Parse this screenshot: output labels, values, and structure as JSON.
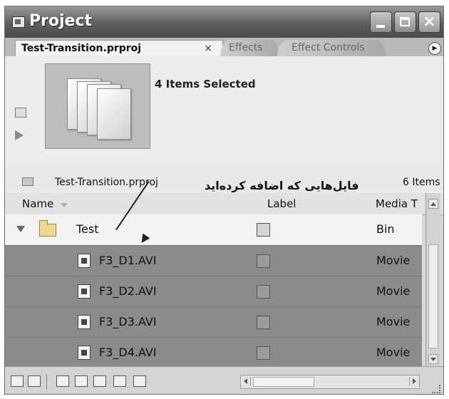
{
  "window": {
    "title": "Project",
    "buttons": {
      "minimize": "minimize-icon",
      "maximize": "maximize-icon",
      "close": "×"
    }
  },
  "tabs": [
    {
      "label": "Test-Transition.prproj",
      "active": true,
      "close": "×"
    },
    {
      "label": "Effects",
      "active": false
    },
    {
      "label": "Effect Controls",
      "active": false
    }
  ],
  "preview": {
    "selection_text": "4 Items Selected"
  },
  "project": {
    "name": "Test-Transition.prproj",
    "item_count": "6 Items"
  },
  "annotation": "فایل‌هایی که اضافه کرده‌اید",
  "columns": {
    "name": "Name",
    "label": "Label",
    "media_type": "Media T"
  },
  "rows": [
    {
      "name": "Test",
      "type": "Bin",
      "selected": false
    },
    {
      "name": "F3_D1.AVI",
      "type": "Movie",
      "selected": true
    },
    {
      "name": "F3_D2.AVI",
      "type": "Movie",
      "selected": true
    },
    {
      "name": "F3_D3.AVI",
      "type": "Movie",
      "selected": true
    },
    {
      "name": "F3_D4.AVI",
      "type": "Movie",
      "selected": true
    }
  ],
  "colors": {
    "titlebar": "#5f5f5f",
    "selection": "#8b8b89",
    "panel": "#d8d8d4"
  }
}
